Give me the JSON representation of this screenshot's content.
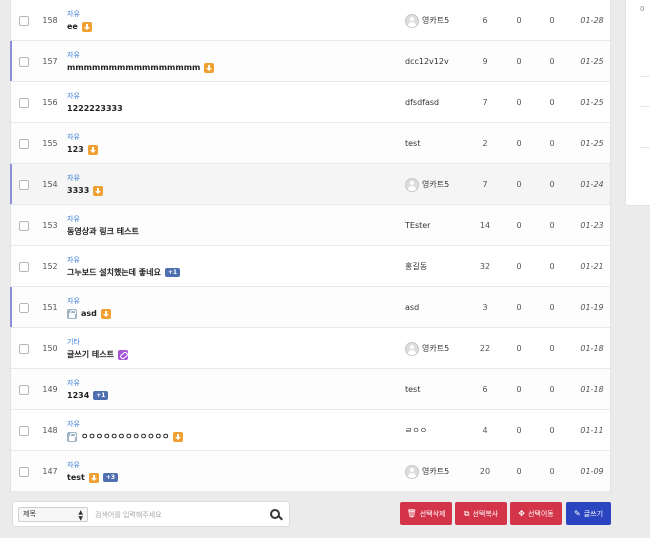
{
  "posts": [
    {
      "num": "158",
      "category": "자유",
      "title": "ee",
      "icons": [
        "download"
      ],
      "comments": "",
      "lock": false,
      "author": "영카트5",
      "avatar": true,
      "hits": "6",
      "good": "0",
      "bad": "0",
      "date": "01-28",
      "highlight": false,
      "marked": false
    },
    {
      "num": "157",
      "category": "자유",
      "title": "mmmmmmmmmmmmmmmm",
      "icons": [
        "download"
      ],
      "comments": "",
      "lock": false,
      "author": "dcc12v12v",
      "avatar": false,
      "hits": "9",
      "good": "0",
      "bad": "0",
      "date": "01-25",
      "highlight": false,
      "marked": true
    },
    {
      "num": "156",
      "category": "자유",
      "title": "1222223333",
      "icons": [],
      "comments": "",
      "lock": false,
      "author": "dfsdfasd",
      "avatar": false,
      "hits": "7",
      "good": "0",
      "bad": "0",
      "date": "01-25",
      "highlight": false,
      "marked": false
    },
    {
      "num": "155",
      "category": "자유",
      "title": "123",
      "icons": [
        "download"
      ],
      "comments": "",
      "lock": false,
      "author": "test",
      "avatar": false,
      "hits": "2",
      "good": "0",
      "bad": "0",
      "date": "01-25",
      "highlight": false,
      "marked": false
    },
    {
      "num": "154",
      "category": "자유",
      "title": "3333",
      "icons": [
        "download"
      ],
      "comments": "",
      "lock": false,
      "author": "영카트5",
      "avatar": true,
      "hits": "7",
      "good": "0",
      "bad": "0",
      "date": "01-24",
      "highlight": true,
      "marked": true
    },
    {
      "num": "153",
      "category": "자유",
      "title": "동영상과 링크 테스트",
      "icons": [],
      "comments": "",
      "lock": false,
      "author": "TEster",
      "avatar": false,
      "hits": "14",
      "good": "0",
      "bad": "0",
      "date": "01-23",
      "highlight": false,
      "marked": false
    },
    {
      "num": "152",
      "category": "자유",
      "title": "그누보드 설치했는데 좋네요",
      "icons": [],
      "comments": "+1",
      "lock": false,
      "author": "홍길동",
      "avatar": false,
      "hits": "32",
      "good": "0",
      "bad": "0",
      "date": "01-21",
      "highlight": false,
      "marked": false
    },
    {
      "num": "151",
      "category": "자유",
      "title": "asd",
      "icons": [
        "download"
      ],
      "comments": "",
      "lock": true,
      "author": "asd",
      "avatar": false,
      "hits": "3",
      "good": "0",
      "bad": "0",
      "date": "01-19",
      "highlight": false,
      "marked": true
    },
    {
      "num": "150",
      "category": "기타",
      "title": "글쓰기 테스트",
      "icons": [
        "link"
      ],
      "comments": "",
      "lock": false,
      "author": "영카트5",
      "avatar": true,
      "hits": "22",
      "good": "0",
      "bad": "0",
      "date": "01-18",
      "highlight": false,
      "marked": false
    },
    {
      "num": "149",
      "category": "자유",
      "title": "1234",
      "icons": [],
      "comments": "+1",
      "lock": false,
      "author": "test",
      "avatar": false,
      "hits": "6",
      "good": "0",
      "bad": "0",
      "date": "01-18",
      "highlight": false,
      "marked": false
    },
    {
      "num": "148",
      "category": "자유",
      "title": "ㅇㅇㅇㅇㅇㅇㅇㅇㅇㅇㅇㅇ",
      "icons": [
        "download"
      ],
      "comments": "",
      "lock": true,
      "author": "ㄹㅇㅇ",
      "avatar": false,
      "hits": "4",
      "good": "0",
      "bad": "0",
      "date": "01-11",
      "highlight": false,
      "marked": false
    },
    {
      "num": "147",
      "category": "자유",
      "title": "test",
      "icons": [
        "download"
      ],
      "comments": "+3",
      "lock": false,
      "author": "영카트5",
      "avatar": true,
      "hits": "20",
      "good": "0",
      "bad": "0",
      "date": "01-09",
      "highlight": false,
      "marked": false
    }
  ],
  "search": {
    "field_selected": "제목",
    "placeholder": "검색어를 입력해주세요",
    "value": ""
  },
  "actions": {
    "delete_label": "선택삭제",
    "copy_label": "선택복사",
    "move_label": "선택이동",
    "write_label": "글쓰기"
  },
  "side": {
    "mark": "0"
  },
  "colors": {
    "category": "#3a7fd6",
    "download_icon": "#f0a030",
    "link_icon": "#a356d6",
    "comment_badge": "#4f6fb0",
    "danger_button": "#d4344a",
    "primary_button": "#2b44c0",
    "row_marker": "#8a8ed6"
  }
}
